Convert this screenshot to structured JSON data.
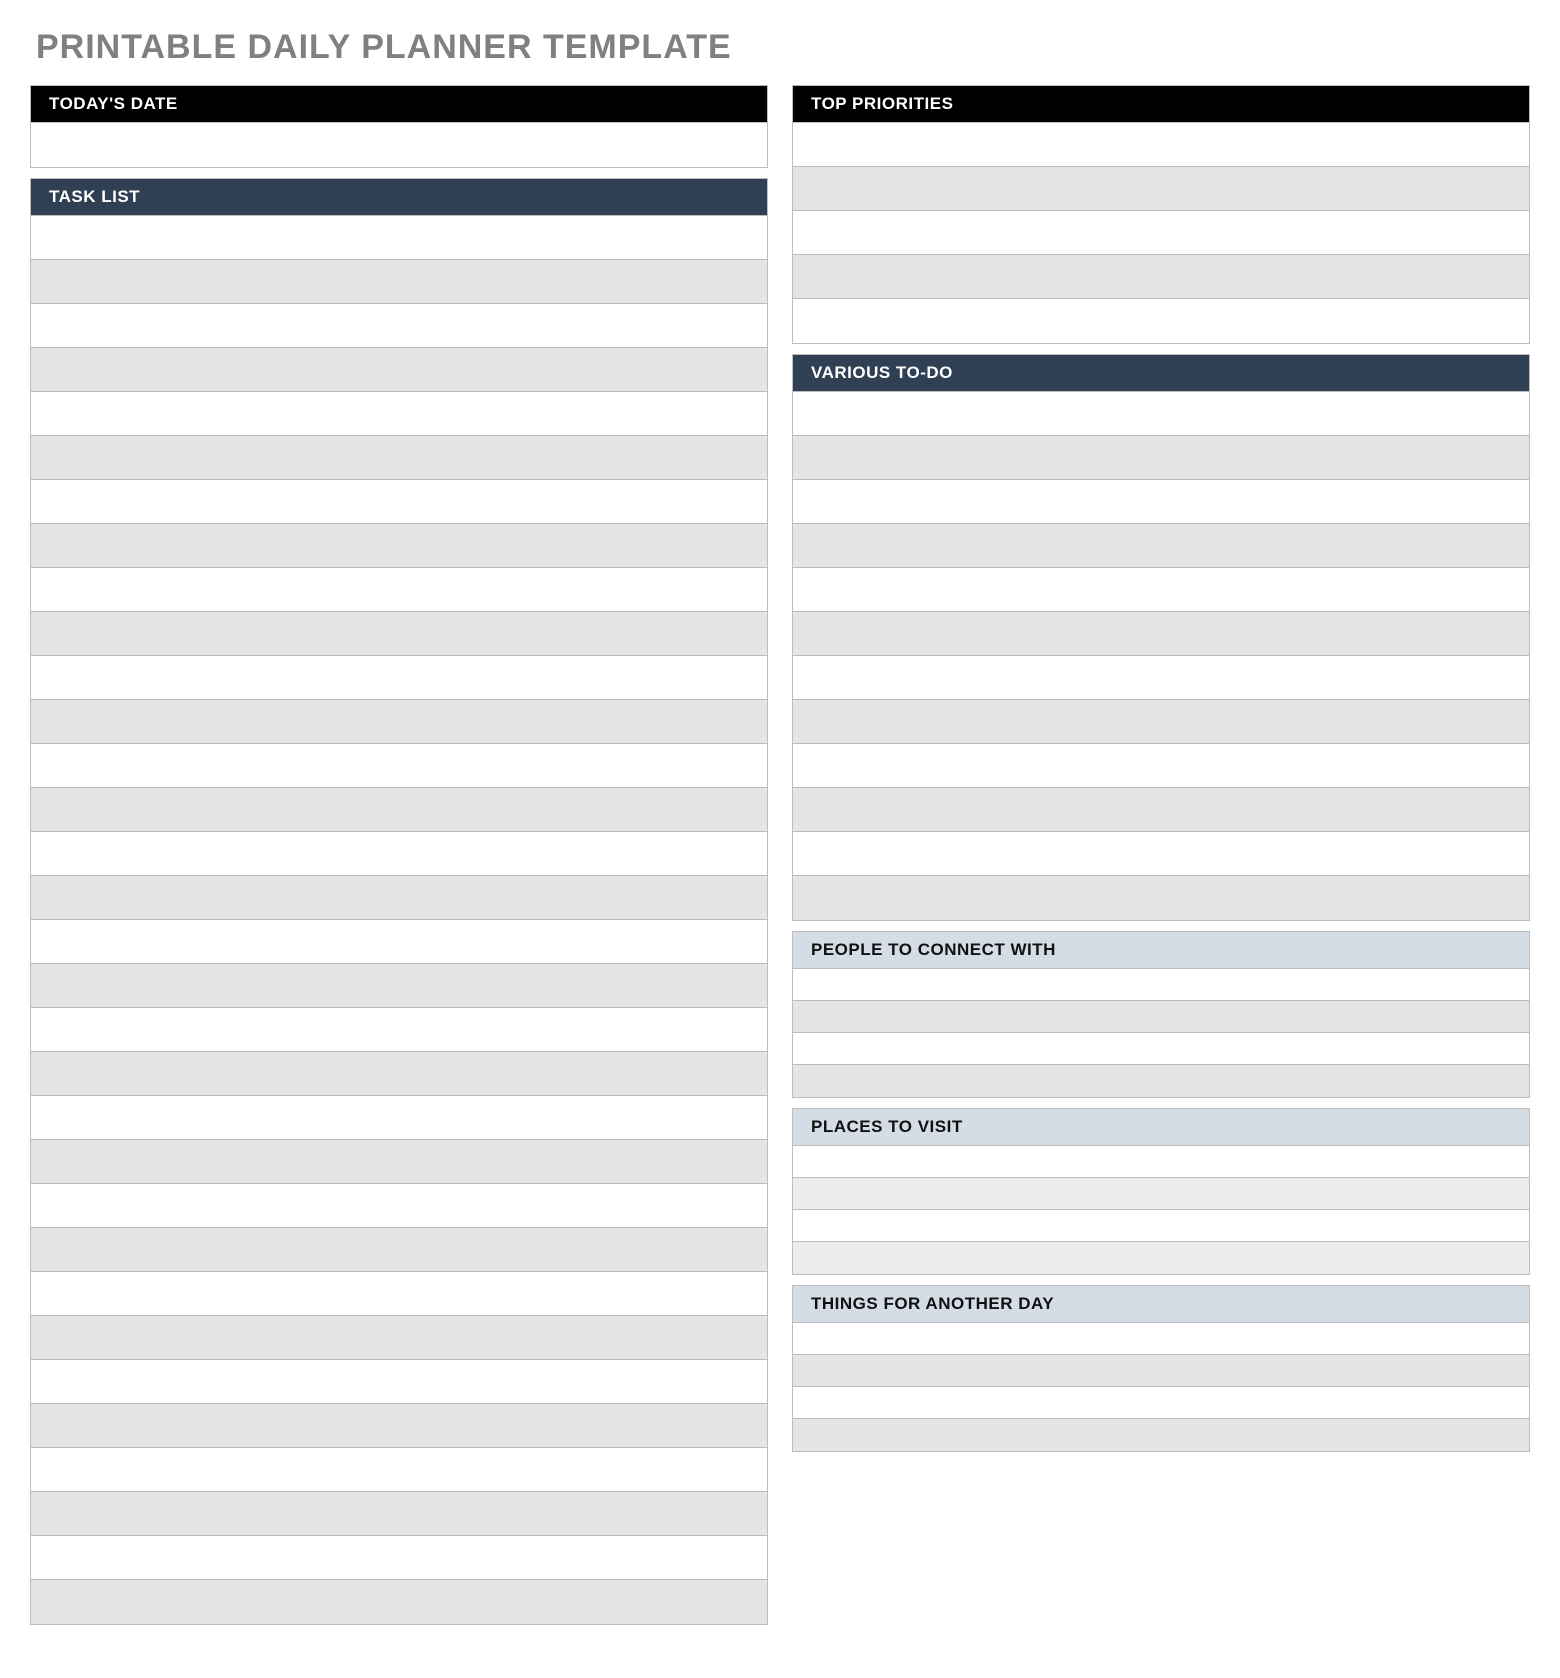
{
  "title": "PRINTABLE DAILY PLANNER TEMPLATE",
  "left": {
    "todaysDate": {
      "label": "TODAY'S DATE"
    },
    "taskList": {
      "label": "TASK LIST"
    }
  },
  "right": {
    "topPriorities": {
      "label": "TOP PRIORITIES"
    },
    "variousTodo": {
      "label": "VARIOUS TO-DO"
    },
    "peopleConnect": {
      "label": "PEOPLE TO CONNECT WITH"
    },
    "placesVisit": {
      "label": "PLACES TO VISIT"
    },
    "anotherDay": {
      "label": "THINGS FOR ANOTHER DAY"
    }
  }
}
